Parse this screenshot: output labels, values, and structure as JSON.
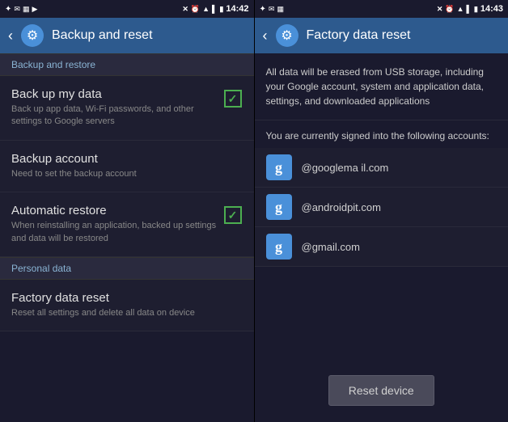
{
  "left_panel": {
    "status_bar": {
      "time": "14:42",
      "left_icons": [
        "☰",
        "✉",
        "▦",
        "▶"
      ],
      "right_icons": [
        "✕",
        "⏰",
        "📶",
        "📶",
        "🔋"
      ]
    },
    "header": {
      "back_label": "‹",
      "gear_icon": "⚙",
      "title": "Backup and reset"
    },
    "sections": [
      {
        "label": "Backup and restore",
        "items": [
          {
            "title": "Back up my data",
            "subtitle": "Back up app data, Wi-Fi passwords, and other settings to Google servers",
            "has_check": true,
            "checked": true
          },
          {
            "title": "Backup account",
            "subtitle": "Need to set the backup account",
            "has_check": false,
            "checked": false
          },
          {
            "title": "Automatic restore",
            "subtitle": "When reinstalling an application, backed up settings and data will be restored",
            "has_check": true,
            "checked": true
          }
        ]
      },
      {
        "label": "Personal data",
        "items": [
          {
            "title": "Factory data reset",
            "subtitle": "Reset all settings and delete all data on device",
            "has_check": false,
            "checked": false
          }
        ]
      }
    ]
  },
  "right_panel": {
    "status_bar": {
      "time": "14:43",
      "left_icons": [
        "☰",
        "✉",
        "▦"
      ],
      "right_icons": [
        "✕",
        "⏰",
        "📶",
        "📶",
        "🔋"
      ]
    },
    "header": {
      "back_label": "‹",
      "gear_icon": "⚙",
      "title": "Factory data reset"
    },
    "description": "All data will be erased from USB storage, including your Google account, system and application data, settings, and downloaded applications",
    "accounts_intro": "You are currently signed into the following accounts:",
    "accounts": [
      {
        "email": "@googlema il.com"
      },
      {
        "email": "@androidpit.com"
      },
      {
        "email": "@gmail.com"
      }
    ],
    "reset_button_label": "Reset device"
  }
}
